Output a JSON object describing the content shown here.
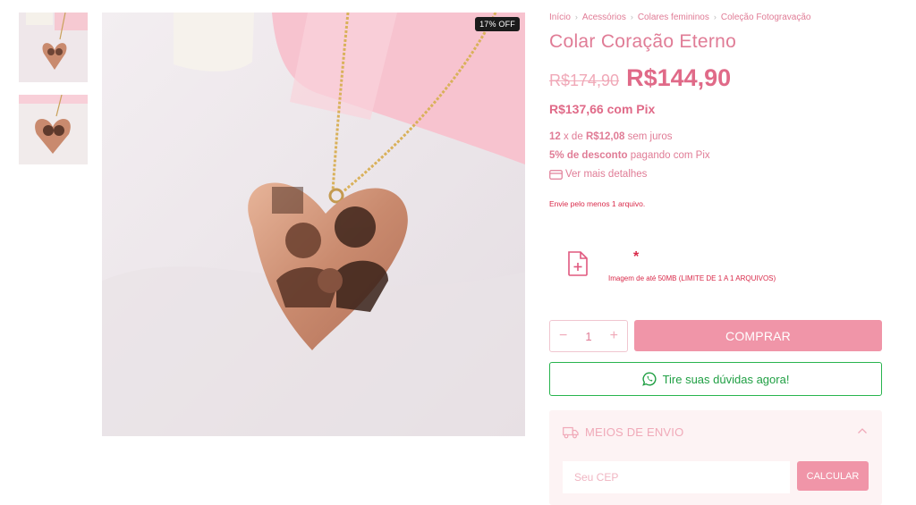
{
  "gallery": {
    "badge": "17% OFF"
  },
  "breadcrumb": [
    "Início",
    "Acessórios",
    "Colares femininos",
    "Coleção Fotogravação"
  ],
  "product": {
    "title": "Colar Coração Eterno",
    "old_price": "R$174,90",
    "price": "R$144,90",
    "pix_price": "R$137,66 com Pix",
    "installments": {
      "count": "12",
      "mid": " x de ",
      "value": "R$12,08",
      "suffix": " sem juros"
    },
    "pix_discount": {
      "bold": "5% de desconto",
      "rest": " pagando com Pix"
    },
    "details_link": "Ver mais detalhes"
  },
  "upload": {
    "warning": "Envie pelo menos 1 arquivo.",
    "star": "*",
    "hint": "Imagem de até 50MB (LIMITE DE 1 A 1 ARQUIVOS)"
  },
  "purchase": {
    "minus": "−",
    "quantity": "1",
    "plus": "+",
    "buy_label": "COMPRAR"
  },
  "whatsapp": {
    "label": "Tire suas dúvidas agora!"
  },
  "shipping": {
    "title": "MEIOS DE ENVIO",
    "cep_placeholder": "Seu CEP",
    "calculate_label": "CALCULAR"
  },
  "colors": {
    "accent": "#e07c96",
    "button": "#f095a8",
    "whatsapp": "#28b44e",
    "error": "#d92a4a"
  }
}
